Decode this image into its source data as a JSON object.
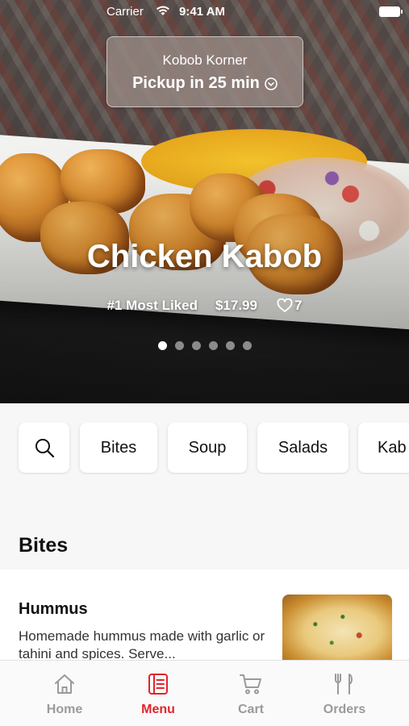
{
  "status_bar": {
    "carrier": "Carrier",
    "time": "9:41 AM"
  },
  "pickup": {
    "store_name": "Kobob Korner",
    "eta_label": "Pickup in 25 min"
  },
  "hero": {
    "dish_title": "Chicken Kabob",
    "rank_label": "#1 Most Liked",
    "price": "$17.99",
    "likes": "7",
    "carousel": {
      "total": 6,
      "active": 1
    }
  },
  "categories": {
    "search_icon": "search-icon",
    "items": [
      "Bites",
      "Soup",
      "Salads",
      "Kab"
    ]
  },
  "section": {
    "title": "Bites"
  },
  "menu_item": {
    "name": "Hummus",
    "description": "Homemade hummus made with garlic or tahini and spices. Serve..."
  },
  "tabs": [
    {
      "label": "Home",
      "icon": "home-icon",
      "active": false
    },
    {
      "label": "Menu",
      "icon": "menu-icon",
      "active": true
    },
    {
      "label": "Cart",
      "icon": "cart-icon",
      "active": false
    },
    {
      "label": "Orders",
      "icon": "orders-icon",
      "active": false
    }
  ],
  "colors": {
    "accent": "#e3242b",
    "inactive_tab": "#9a9a9a"
  }
}
